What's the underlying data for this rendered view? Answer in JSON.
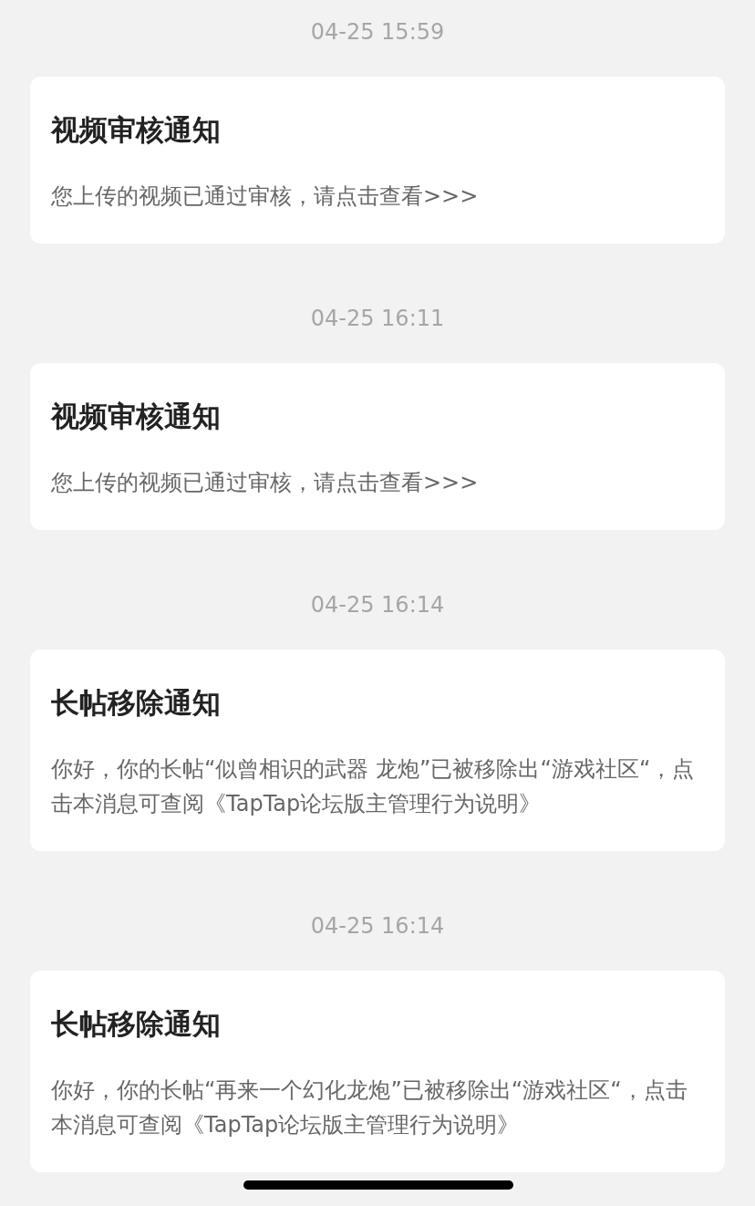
{
  "messages": [
    {
      "time": "04-25 15:59",
      "title": "视频审核通知",
      "body": "您上传的视频已通过审核，请点击查看>>>"
    },
    {
      "time": "04-25 16:11",
      "title": "视频审核通知",
      "body": "您上传的视频已通过审核，请点击查看>>>"
    },
    {
      "time": "04-25 16:14",
      "title": "长帖移除通知",
      "body": "你好，你的长帖“似曾相识的武器 龙炮”已被移除出“游戏社区“，点击本消息可查阅《TapTap论坛版主管理行为说明》"
    },
    {
      "time": "04-25 16:14",
      "title": "长帖移除通知",
      "body": "你好，你的长帖“再来一个幻化龙炮”已被移除出“游戏社区“，点击本消息可查阅《TapTap论坛版主管理行为说明》"
    }
  ]
}
